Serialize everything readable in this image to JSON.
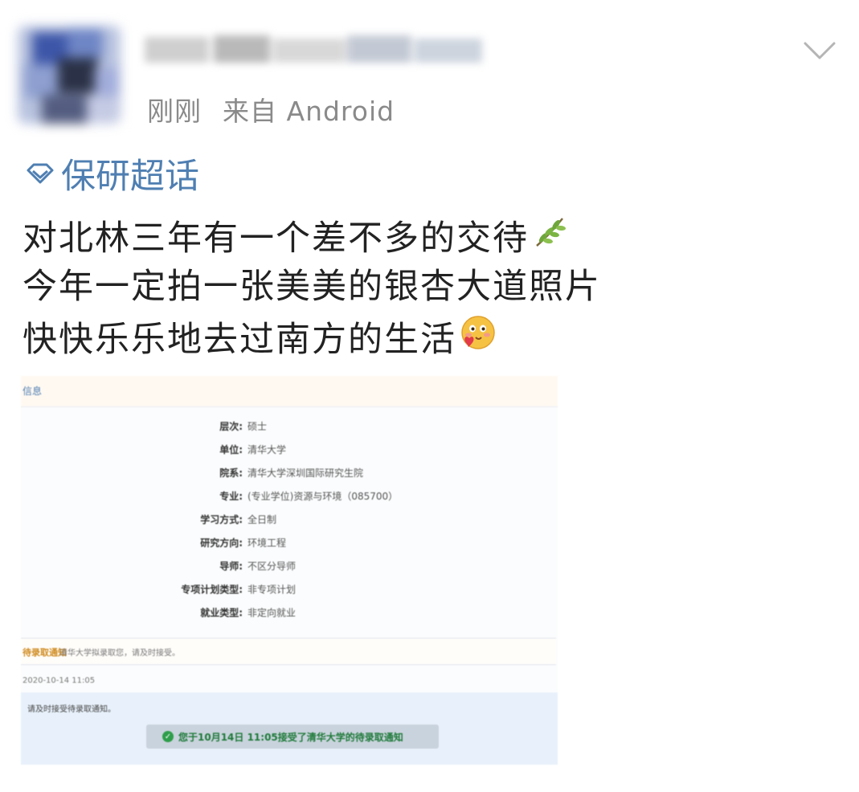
{
  "post": {
    "time": "刚刚",
    "source": "来自 Android",
    "topic": "保研超话",
    "lines": [
      "对北林三年有一个差不多的交待",
      "今年一定拍一张美美的银杏大道照片",
      "快快乐乐地去过南方的生活"
    ],
    "emoji": [
      "leaf-emoji",
      "blushing-heart-emoji"
    ],
    "topic_color": "#4f7fb2"
  },
  "screenshot": {
    "header_tag": "信息",
    "fields": [
      {
        "k": "层次:",
        "v": "硕士"
      },
      {
        "k": "单位:",
        "v": "清华大学"
      },
      {
        "k": "院系:",
        "v": "清华大学深圳国际研究生院"
      },
      {
        "k": "专业:",
        "v": "(专业学位)资源与环境（085700）"
      },
      {
        "k": "学习方式:",
        "v": "全日制"
      },
      {
        "k": "研究方向:",
        "v": "环境工程"
      },
      {
        "k": "导师:",
        "v": "不区分导师"
      },
      {
        "k": "专项计划类型:",
        "v": "非专项计划"
      },
      {
        "k": "就业类型:",
        "v": "非定向就业"
      }
    ],
    "notice_label": "待录取通知",
    "notice_text": "清华大学拟录取您，请及时接受。",
    "date_line": "2020-10-14 11:05",
    "accept_hint": "请及时接受待录取通知。",
    "accept_status": "您于10月14日 11:05接受了清华大学的待录取通知",
    "accept_color": "#1f7a3a"
  }
}
